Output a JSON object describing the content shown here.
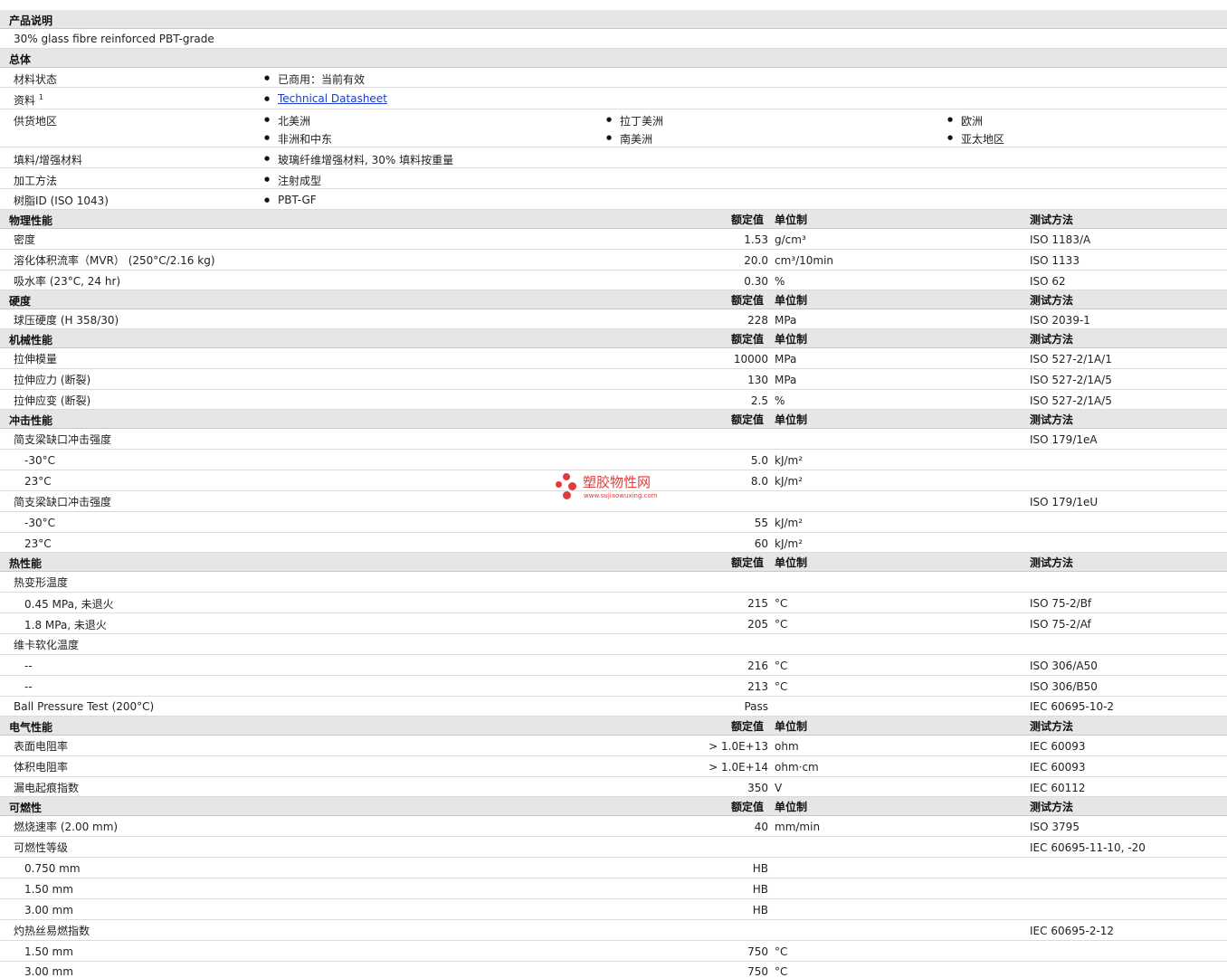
{
  "product_description": {
    "header": "产品说明",
    "text": "30% glass fibre reinforced PBT-grade"
  },
  "general": {
    "header": "总体",
    "material_status": {
      "label": "材料状态",
      "value": "已商用：当前有效"
    },
    "document": {
      "label": "资料",
      "sup": "1",
      "link": "Technical Datasheet"
    },
    "regions": {
      "label": "供货地区",
      "items": [
        "北美洲",
        "拉丁美洲",
        "欧洲",
        "非洲和中东",
        "南美洲",
        "亚太地区"
      ]
    },
    "filler": {
      "label": "填料/增强材料",
      "value": "玻璃纤维增强材料, 30% 填料按重量"
    },
    "processing": {
      "label": "加工方法",
      "value": "注射成型"
    },
    "resin_id": {
      "label": "树脂ID (ISO 1043)",
      "value": "PBT-GF"
    }
  },
  "columns": {
    "value": "额定值",
    "unit": "单位制",
    "method": "测试方法"
  },
  "physical": {
    "header": "物理性能",
    "rows": [
      {
        "label": "密度",
        "value": "1.53",
        "unit": "g/cm³",
        "method": "ISO 1183/A"
      },
      {
        "label": "溶化体积流率（MVR） (250°C/2.16 kg)",
        "value": "20.0",
        "unit": "cm³/10min",
        "method": "ISO 1133"
      },
      {
        "label": "吸水率 (23°C, 24 hr)",
        "value": "0.30",
        "unit": "%",
        "method": "ISO 62"
      }
    ]
  },
  "hardness": {
    "header": "硬度",
    "rows": [
      {
        "label": "球压硬度 (H 358/30)",
        "value": "228",
        "unit": "MPa",
        "method": "ISO 2039-1"
      }
    ]
  },
  "mechanical": {
    "header": "机械性能",
    "rows": [
      {
        "label": "拉伸模量",
        "value": "10000",
        "unit": "MPa",
        "method": "ISO 527-2/1A/1"
      },
      {
        "label": "拉伸应力 (断裂)",
        "value": "130",
        "unit": "MPa",
        "method": "ISO 527-2/1A/5"
      },
      {
        "label": "拉伸应变 (断裂)",
        "value": "2.5",
        "unit": "%",
        "method": "ISO 527-2/1A/5"
      }
    ]
  },
  "impact": {
    "header": "冲击性能",
    "rows": [
      {
        "label": "简支梁缺口冲击强度",
        "value": "",
        "unit": "",
        "method": "ISO 179/1eA"
      },
      {
        "label": "-30°C",
        "value": "5.0",
        "unit": "kJ/m²",
        "method": ""
      },
      {
        "label": "23°C",
        "value": "8.0",
        "unit": "kJ/m²",
        "method": ""
      },
      {
        "label": "简支梁缺口冲击强度",
        "value": "",
        "unit": "",
        "method": "ISO 179/1eU"
      },
      {
        "label": "-30°C",
        "value": "55",
        "unit": "kJ/m²",
        "method": ""
      },
      {
        "label": "23°C",
        "value": "60",
        "unit": "kJ/m²",
        "method": ""
      }
    ]
  },
  "thermal": {
    "header": "热性能",
    "rows": [
      {
        "label": "热变形温度",
        "value": "",
        "unit": "",
        "method": ""
      },
      {
        "label": "0.45 MPa, 未退火",
        "value": "215",
        "unit": "°C",
        "method": "ISO 75-2/Bf"
      },
      {
        "label": "1.8 MPa, 未退火",
        "value": "205",
        "unit": "°C",
        "method": "ISO 75-2/Af"
      },
      {
        "label": "维卡软化温度",
        "value": "",
        "unit": "",
        "method": ""
      },
      {
        "label": "--",
        "value": "216",
        "unit": "°C",
        "method": "ISO 306/A50"
      },
      {
        "label": "--",
        "value": "213",
        "unit": "°C",
        "method": "ISO 306/B50"
      },
      {
        "label": "Ball Pressure Test (200°C)",
        "value": "Pass",
        "unit": "",
        "method": "IEC 60695-10-2"
      }
    ]
  },
  "electrical": {
    "header": "电气性能",
    "rows": [
      {
        "label": "表面电阻率",
        "value": "> 1.0E+13",
        "unit": "ohm",
        "method": "IEC 60093"
      },
      {
        "label": "体积电阻率",
        "value": "> 1.0E+14",
        "unit": "ohm·cm",
        "method": "IEC 60093"
      },
      {
        "label": "漏电起痕指数",
        "value": "350",
        "unit": "V",
        "method": "IEC 60112"
      }
    ]
  },
  "flammability": {
    "header": "可燃性",
    "rows": [
      {
        "label": "燃烧速率 (2.00 mm)",
        "value": "40",
        "unit": "mm/min",
        "method": "ISO 3795"
      },
      {
        "label": "可燃性等级",
        "value": "",
        "unit": "",
        "method": "IEC 60695-11-10, -20"
      },
      {
        "label": "0.750 mm",
        "value": "HB",
        "unit": "",
        "method": ""
      },
      {
        "label": "1.50 mm",
        "value": "HB",
        "unit": "",
        "method": ""
      },
      {
        "label": "3.00 mm",
        "value": "HB",
        "unit": "",
        "method": ""
      },
      {
        "label": "灼热丝易燃指数",
        "value": "",
        "unit": "",
        "method": "IEC 60695-2-12"
      },
      {
        "label": "1.50 mm",
        "value": "750",
        "unit": "°C",
        "method": ""
      },
      {
        "label": "3.00 mm",
        "value": "750",
        "unit": "°C",
        "method": ""
      }
    ]
  },
  "watermark": {
    "name": "塑胶物性网",
    "url": "www.sujiaowuxing.com"
  }
}
